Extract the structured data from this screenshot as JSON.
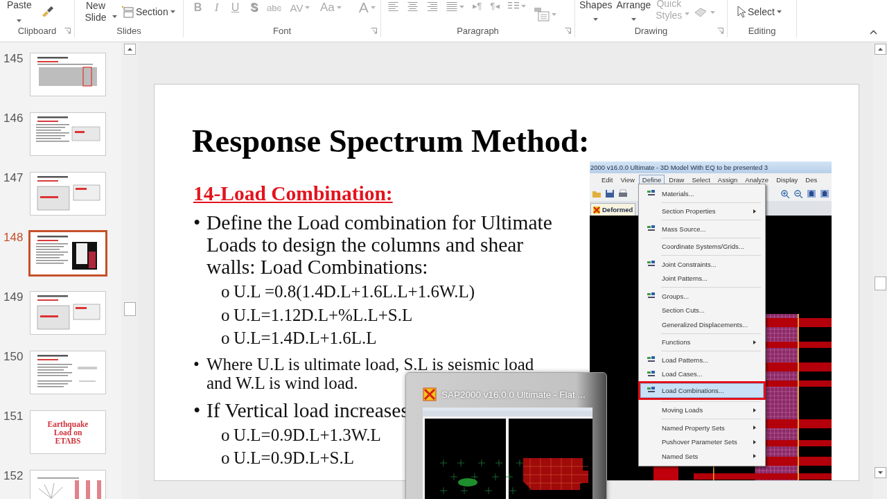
{
  "ribbon": {
    "clipboard": {
      "label": "Clipboard",
      "paste": "Paste"
    },
    "slides": {
      "label": "Slides",
      "new_slide": "New Slide",
      "section": "Section"
    },
    "font": {
      "label": "Font",
      "buttons": [
        {
          "label": "B",
          "kind": "bold",
          "disabled": true
        },
        {
          "label": "I",
          "kind": "italic",
          "disabled": true
        },
        {
          "label": "U",
          "kind": "underline",
          "disabled": true
        },
        {
          "label": "S",
          "kind": "shadow",
          "disabled": true
        },
        {
          "label": "abc",
          "kind": "strike",
          "disabled": true
        },
        {
          "label": "AV",
          "kind": "spacing",
          "disabled": true
        },
        {
          "label": "Aa",
          "kind": "case",
          "disabled": true
        },
        {
          "label": "A",
          "kind": "color",
          "disabled": true
        }
      ]
    },
    "paragraph": {
      "label": "Paragraph",
      "direction_buttons": [
        "▸¶",
        "¶◂"
      ]
    },
    "drawing": {
      "label": "Drawing",
      "shapes": "Shapes",
      "arrange": "Arrange",
      "quick_styles": {
        "label": "Quick Styles",
        "disabled": true
      }
    },
    "editing": {
      "label": "Editing",
      "select": "Select"
    }
  },
  "thumbnails": [
    {
      "number": "145",
      "kind": "table",
      "selected": false
    },
    {
      "number": "146",
      "kind": "text-image",
      "selected": false
    },
    {
      "number": "147",
      "kind": "images",
      "selected": false
    },
    {
      "number": "148",
      "kind": "text-dark-image",
      "selected": true
    },
    {
      "number": "149",
      "kind": "images",
      "selected": false
    },
    {
      "number": "150",
      "kind": "text",
      "selected": false
    },
    {
      "number": "151",
      "kind": "title",
      "title": "Earthquake Load on ETABS",
      "selected": false
    },
    {
      "number": "152",
      "kind": "chart",
      "selected": false
    }
  ],
  "slide": {
    "title": "Response Spectrum Method:",
    "subheading": "14-Load Combination:",
    "bullets": [
      {
        "marker": "•",
        "kind": "large",
        "text": "Define the Load combination for Ultimate Loads to design the columns and shear walls: Load Combinations:",
        "sub_items": [
          {
            "marker": "o",
            "text": "U.L =0.8(1.4D.L+1.6L.L+1.6W.L)"
          },
          {
            "marker": "o",
            "text": "U.L=1.12D.L+%L.L+S.L"
          },
          {
            "marker": "o",
            "text": "U.L=1.4D.L+1.6L.L"
          }
        ]
      },
      {
        "marker": "•",
        "kind": "small",
        "text": "Where U.L is ultimate load, S.L is seismic load and W.L is wind load."
      },
      {
        "marker": "•",
        "kind": "large",
        "text": "If Vertical load increases",
        "sub_items": [
          {
            "marker": "o",
            "text": "U.L=0.9D.L+1.3W.L"
          },
          {
            "marker": "o",
            "text": "U.L=0.9D.L+S.L"
          }
        ]
      }
    ]
  },
  "sap_window": {
    "title": "2000 v16.0.0 Ultimate  -  3D  Model With EQ to be presented 3",
    "menus": [
      {
        "label": "Edit",
        "selected": false
      },
      {
        "label": "View",
        "selected": false
      },
      {
        "label": "Define",
        "selected": true
      },
      {
        "label": "Draw",
        "selected": false
      },
      {
        "label": "Select",
        "selected": false
      },
      {
        "label": "Assign",
        "selected": false
      },
      {
        "label": "Analyze",
        "selected": false
      },
      {
        "label": "Display",
        "selected": false
      },
      {
        "label": "Des",
        "selected": false
      }
    ],
    "tab": "Deformed",
    "define_menu": {
      "groups": [
        {
          "items": [
            {
              "label": "Materials...",
              "icon": true,
              "submenu": false,
              "selected": false
            }
          ]
        },
        {
          "items": [
            {
              "label": "Section Properties",
              "icon": false,
              "submenu": true,
              "selected": false
            }
          ]
        },
        {
          "items": [
            {
              "label": "Mass Source...",
              "icon": true,
              "submenu": false,
              "selected": false
            }
          ]
        },
        {
          "items": [
            {
              "label": "Coordinate Systems/Grids...",
              "icon": false,
              "submenu": false,
              "selected": false
            }
          ]
        },
        {
          "items": [
            {
              "label": "Joint Constraints...",
              "icon": true,
              "submenu": false,
              "selected": false
            },
            {
              "label": "Joint Patterns...",
              "icon": false,
              "submenu": false,
              "selected": false
            }
          ]
        },
        {
          "items": [
            {
              "label": "Groups...",
              "icon": true,
              "submenu": false,
              "selected": false
            },
            {
              "label": "Section Cuts...",
              "icon": false,
              "submenu": false,
              "selected": false
            },
            {
              "label": "Generalized Displacements...",
              "icon": false,
              "submenu": false,
              "selected": false
            }
          ]
        },
        {
          "items": [
            {
              "label": "Functions",
              "icon": false,
              "submenu": true,
              "selected": false
            }
          ]
        },
        {
          "items": [
            {
              "label": "Load Patterns...",
              "icon": true,
              "submenu": false,
              "selected": false
            },
            {
              "label": "Load Cases...",
              "icon": true,
              "submenu": false,
              "selected": false
            },
            {
              "label": "Load Combinations...",
              "icon": true,
              "submenu": false,
              "selected": true
            }
          ]
        },
        {
          "items": [
            {
              "label": "Moving Loads",
              "icon": false,
              "submenu": true,
              "selected": false
            }
          ]
        },
        {
          "items": [
            {
              "label": "Named Property Sets",
              "icon": false,
              "submenu": true,
              "selected": false
            },
            {
              "label": "Pushover Parameter Sets",
              "icon": false,
              "submenu": true,
              "selected": false
            },
            {
              "label": "Named Sets",
              "icon": false,
              "submenu": true,
              "selected": false
            }
          ]
        }
      ]
    }
  },
  "preview": {
    "title": "SAP2000 v16.0.0 Ultimate  - Flat ..."
  }
}
